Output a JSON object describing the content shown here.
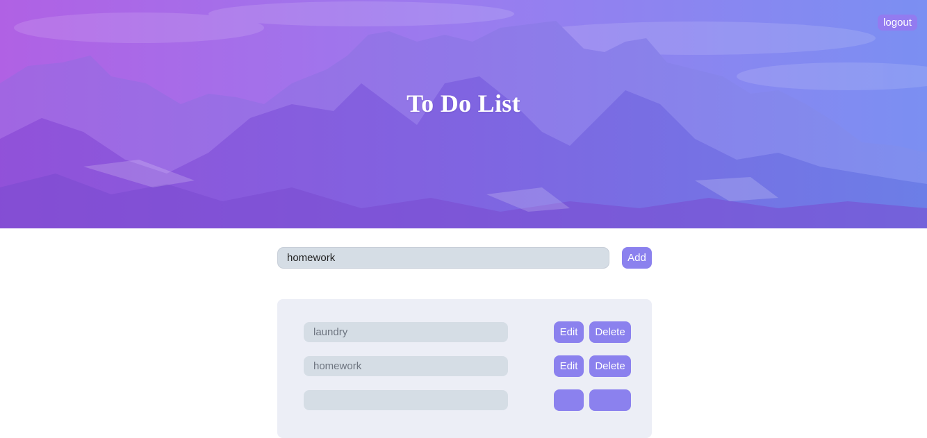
{
  "header": {
    "title": "To Do List",
    "logout_label": "logout"
  },
  "add_form": {
    "input_value": "homework",
    "add_label": "Add"
  },
  "todos": [
    {
      "text": "laundry",
      "edit_label": "Edit",
      "delete_label": "Delete"
    },
    {
      "text": "homework",
      "edit_label": "Edit",
      "delete_label": "Delete"
    },
    {
      "text": "",
      "edit_label": "",
      "delete_label": ""
    }
  ],
  "colors": {
    "accent": "#8b81ee",
    "hero_gradient_start": "#a35ae8",
    "hero_gradient_end": "#6e86ee",
    "input_bg": "#d5dde5",
    "panel_bg": "#eceef6"
  }
}
